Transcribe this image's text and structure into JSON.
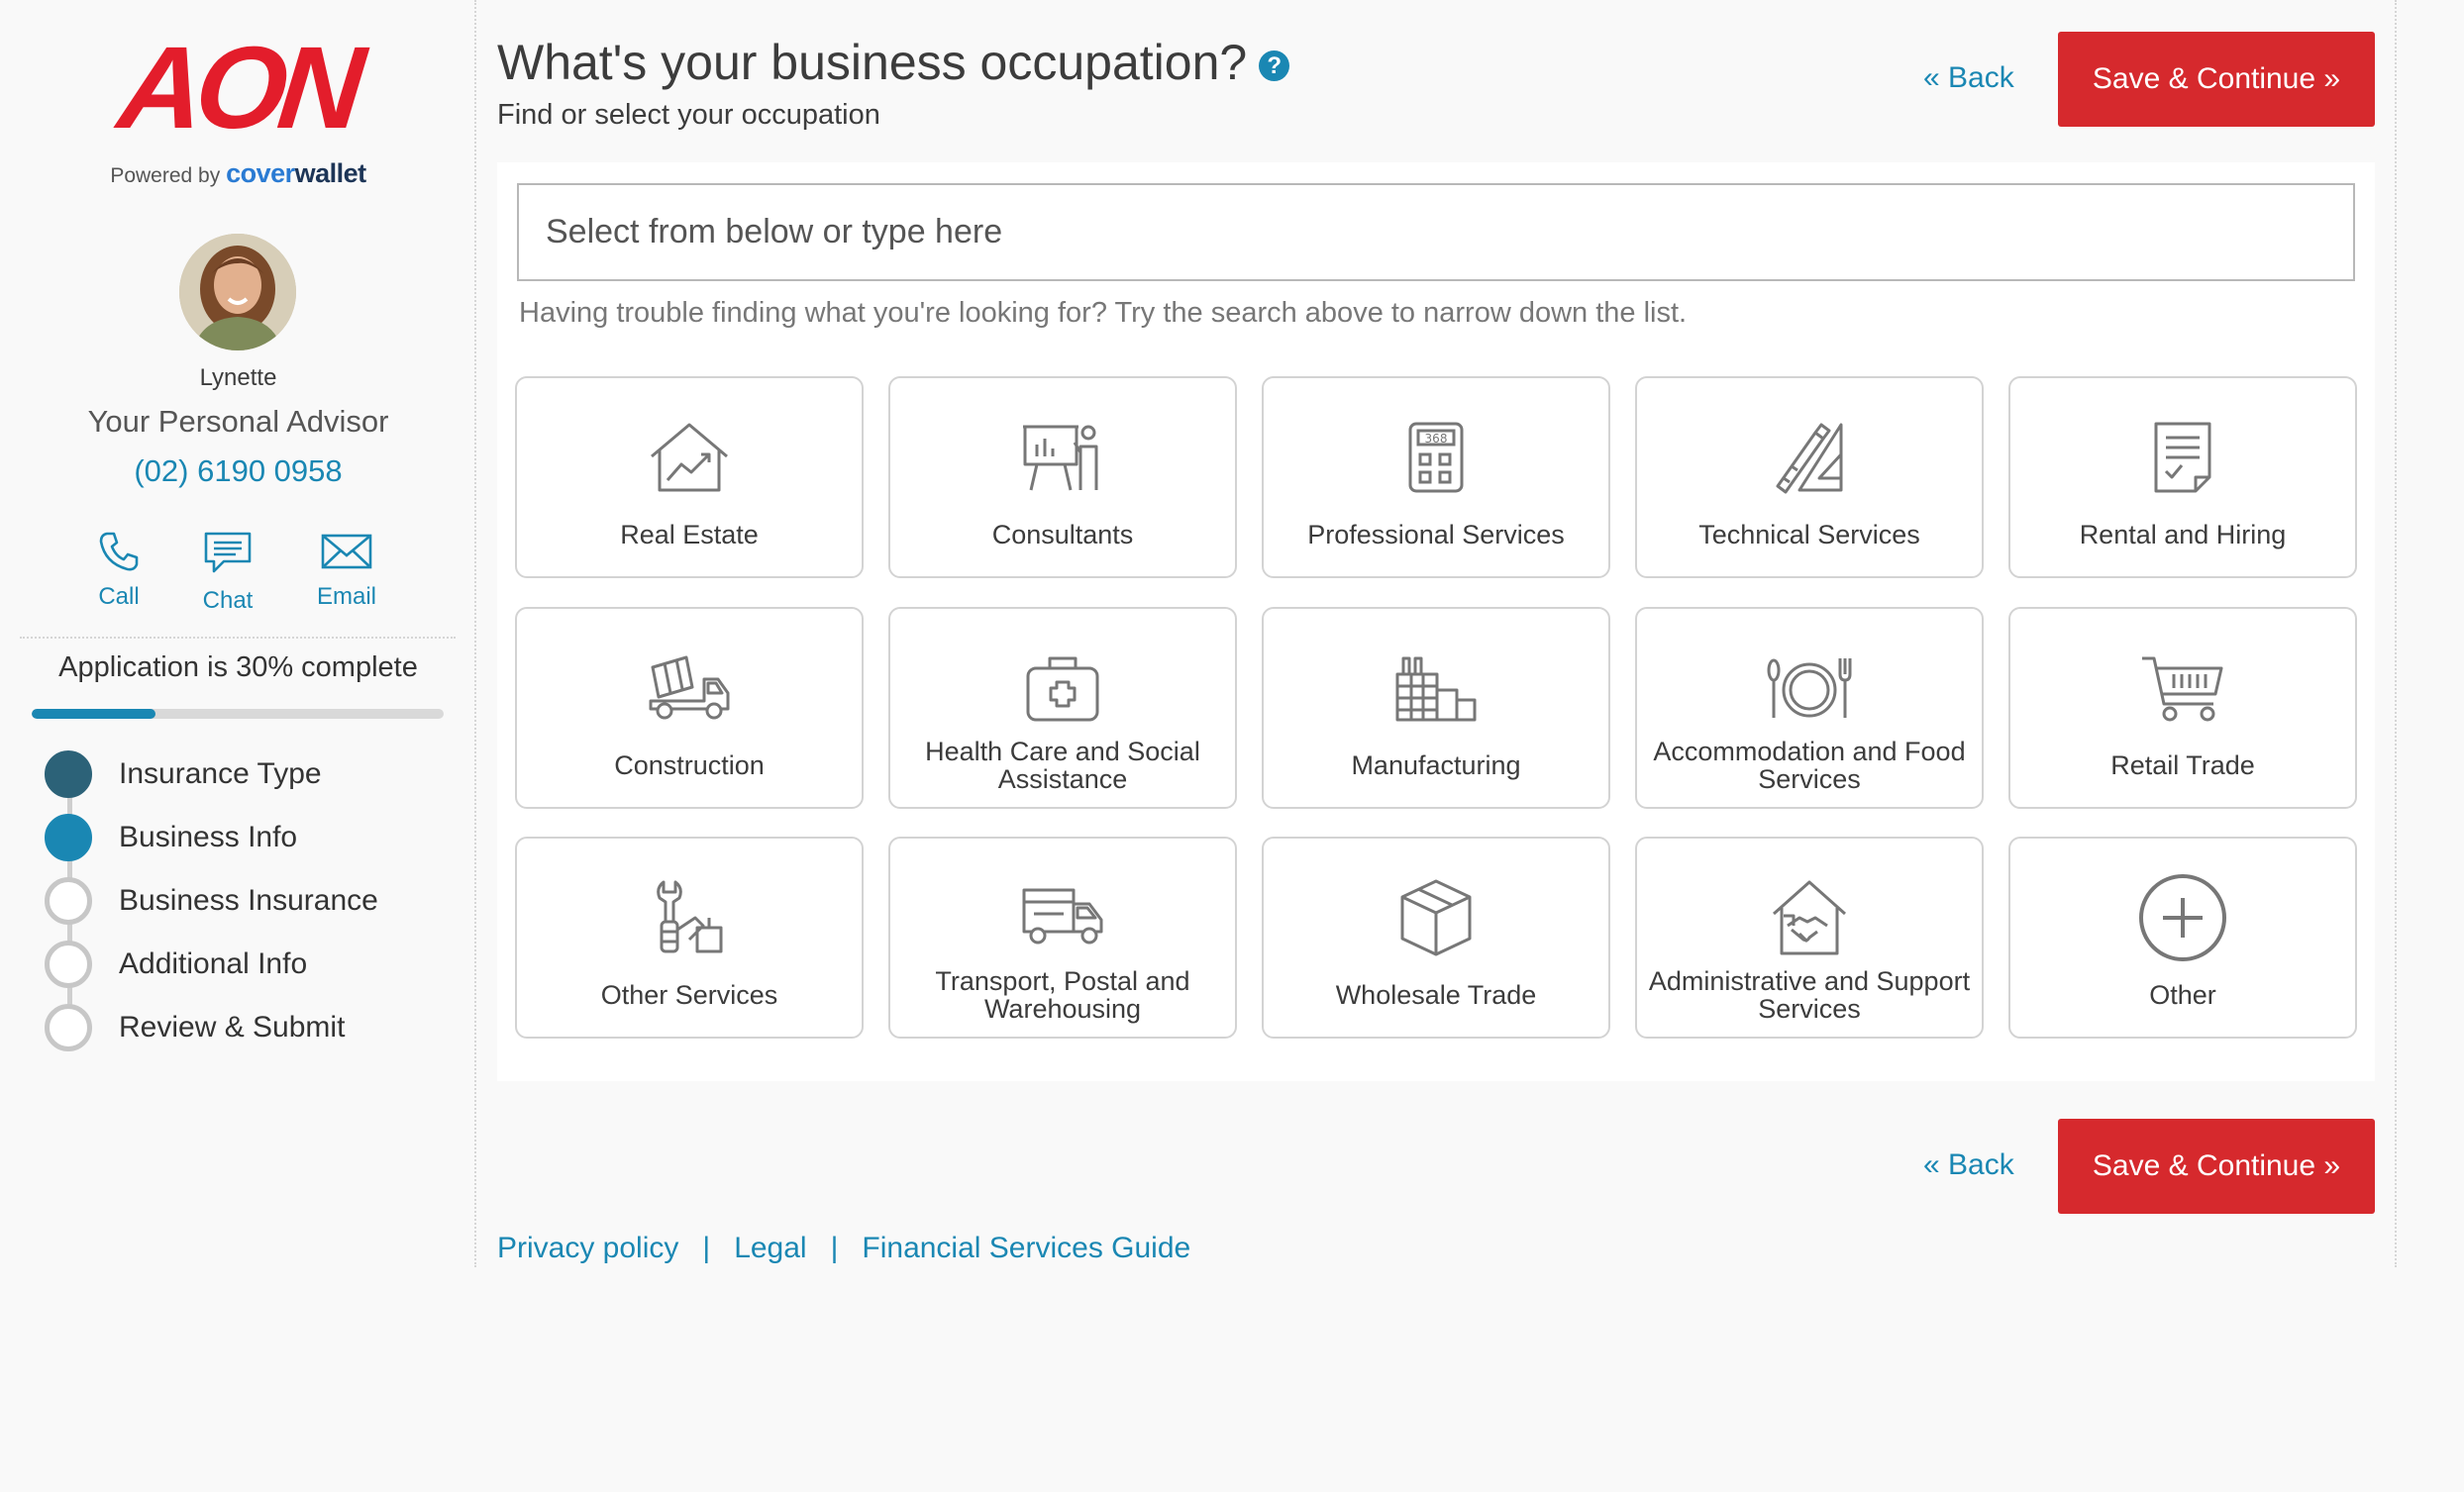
{
  "brand": {
    "logo_text": "AON",
    "powered_by": "Powered by",
    "partner_a": "cover",
    "partner_b": "wallet",
    "accent": "#e31d2b"
  },
  "advisor": {
    "name": "Lynette",
    "role": "Your Personal Advisor",
    "phone": "(02) 6190 0958"
  },
  "contact": {
    "call": "Call",
    "chat": "Chat",
    "email": "Email"
  },
  "progress": {
    "label": "Application is 30% complete",
    "percent": 30
  },
  "steps": [
    {
      "label": "Insurance Type",
      "state": "done"
    },
    {
      "label": "Business Info",
      "state": "active"
    },
    {
      "label": "Business Insurance",
      "state": "todo"
    },
    {
      "label": "Additional Info",
      "state": "todo"
    },
    {
      "label": "Review & Submit",
      "state": "todo"
    }
  ],
  "page": {
    "title": "What's your business occupation?",
    "help_icon": "?",
    "subtitle": "Find or select your occupation",
    "back": "« Back",
    "save": "Save & Continue »"
  },
  "search": {
    "placeholder": "Select from below or type here",
    "hint": "Having trouble finding what you're looking for? Try the search above to narrow down the list."
  },
  "occupations": [
    {
      "label": "Real Estate",
      "icon": "house-chart-icon"
    },
    {
      "label": "Consultants",
      "icon": "presenter-board-icon"
    },
    {
      "label": "Professional Services",
      "icon": "calculator-icon"
    },
    {
      "label": "Technical Services",
      "icon": "drafting-tools-icon"
    },
    {
      "label": "Rental and Hiring",
      "icon": "contract-document-icon"
    },
    {
      "label": "Construction",
      "icon": "cement-truck-icon"
    },
    {
      "label": "Health Care and Social Assistance",
      "icon": "first-aid-kit-icon"
    },
    {
      "label": "Manufacturing",
      "icon": "factory-icon"
    },
    {
      "label": "Accommodation and Food Services",
      "icon": "plate-cutlery-icon"
    },
    {
      "label": "Retail Trade",
      "icon": "shopping-cart-icon"
    },
    {
      "label": "Other Services",
      "icon": "tools-icon"
    },
    {
      "label": "Transport, Postal and Warehousing",
      "icon": "delivery-truck-icon"
    },
    {
      "label": "Wholesale Trade",
      "icon": "package-box-icon"
    },
    {
      "label": "Administrative and Support Services",
      "icon": "house-handshake-icon"
    },
    {
      "label": "Other",
      "icon": "plus-circle-icon"
    }
  ],
  "footer": {
    "privacy": "Privacy policy",
    "legal": "Legal",
    "fsg": "Financial Services Guide",
    "separator": "|"
  },
  "colors": {
    "primary": "#1a87b3",
    "button": "#d6292d",
    "step_done": "#2c6278"
  }
}
